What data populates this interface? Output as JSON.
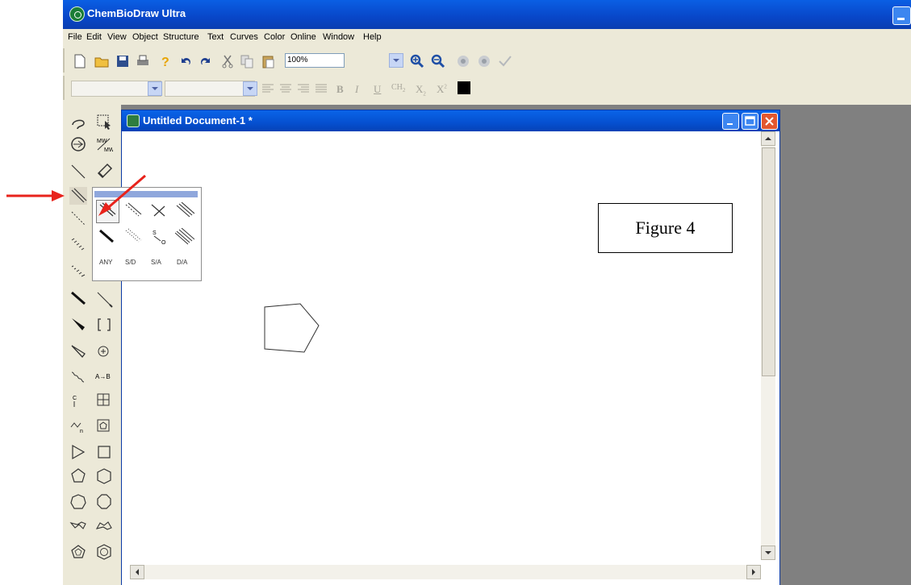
{
  "app": {
    "title": "ChemBioDraw Ultra"
  },
  "menu": [
    "File",
    "Edit",
    "View",
    "Object",
    "Structure",
    "Text",
    "Curves",
    "Color",
    "Online",
    "Window",
    "Help"
  ],
  "toolbar": {
    "zoom": "100%"
  },
  "format_bar": {
    "bold": "B",
    "italic": "I",
    "underline": "U",
    "ch2": "CH",
    "sub": "X",
    "sup": "X"
  },
  "document": {
    "title": "Untitled Document-1 *"
  },
  "figure_label": "Figure 4",
  "bond_popup": {
    "labels": [
      "ANY",
      "S/D",
      "S/A",
      "D/A"
    ]
  },
  "colors": {
    "annotation_arrow": "#e8231c",
    "titlebar": "#0a5fe4",
    "canvas_bg": "#808080"
  }
}
